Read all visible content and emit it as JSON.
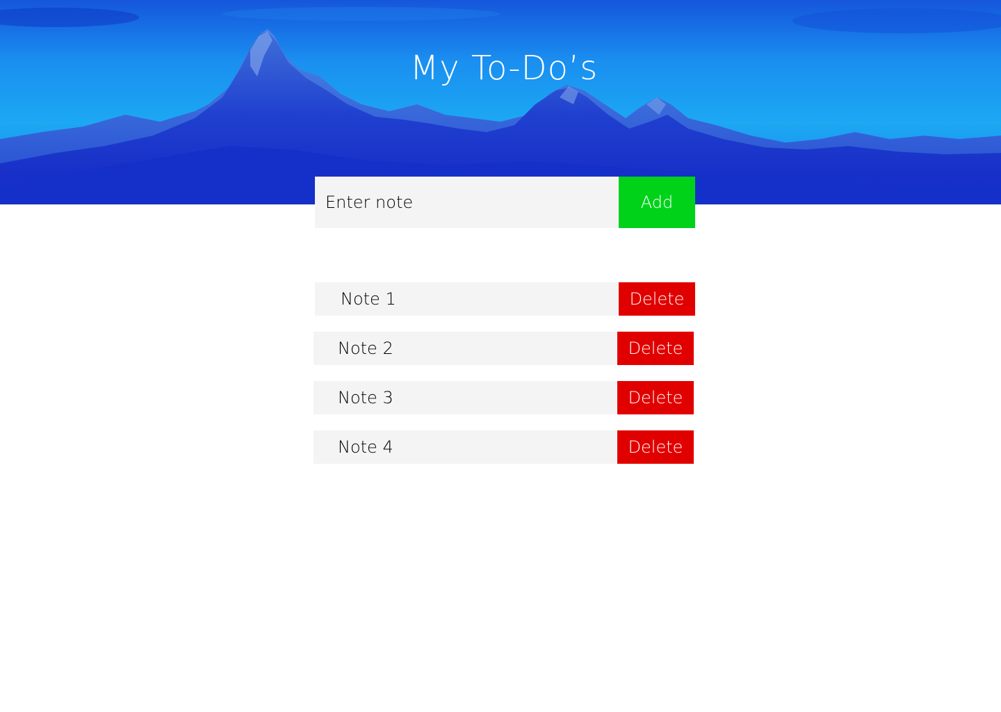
{
  "header": {
    "title": "My To-Do’s"
  },
  "add_form": {
    "input_value": "",
    "input_placeholder": "Enter note",
    "add_label": "Add"
  },
  "notes": [
    {
      "text": "Note 1",
      "delete_label": "Delete"
    },
    {
      "text": "Note 2",
      "delete_label": "Delete"
    },
    {
      "text": "Note 3",
      "delete_label": "Delete"
    },
    {
      "text": "Note 4",
      "delete_label": "Delete"
    }
  ],
  "colors": {
    "hero_blue": "#1a6ee8",
    "input_background": "#f4f4f4",
    "add_button": "#00d21a",
    "delete_button": "#e10000",
    "button_text": "#ffffff"
  }
}
